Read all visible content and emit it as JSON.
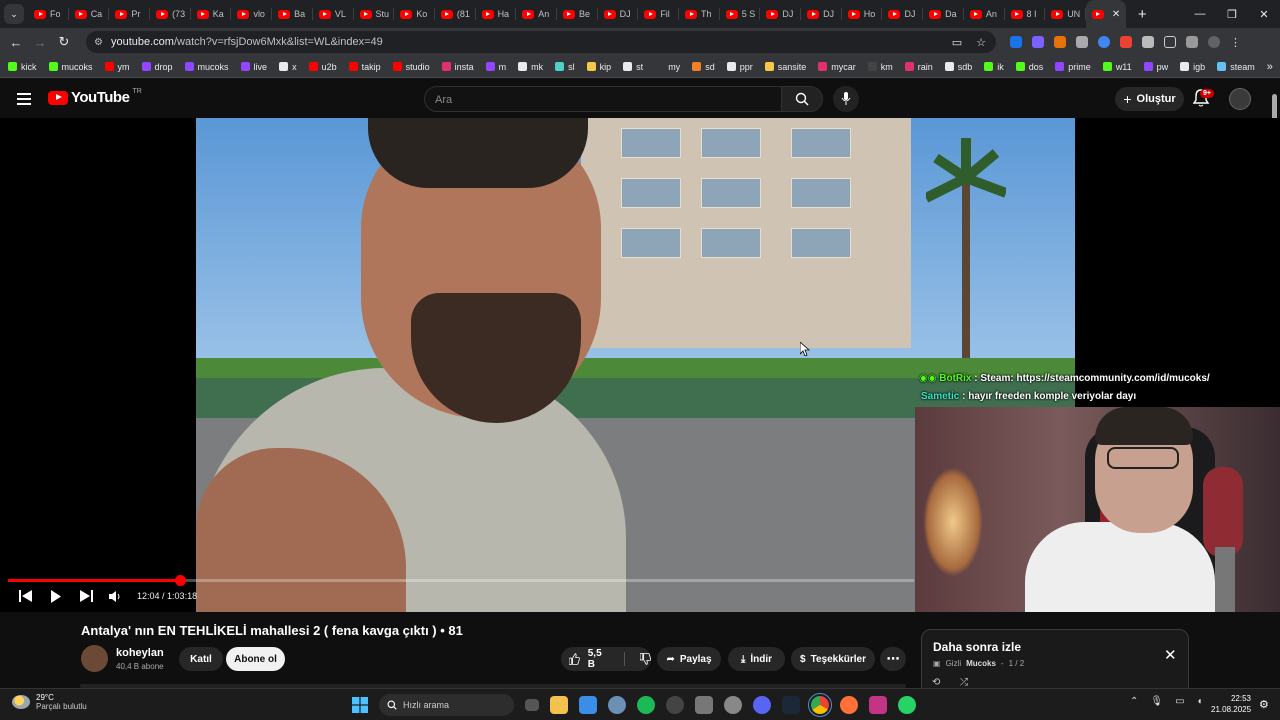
{
  "browser": {
    "tabs": [
      "Fo",
      "Ca",
      "Pr",
      "(73",
      "Ka",
      "vlo",
      "Ba",
      "VL",
      "Stu",
      "Ko",
      "(81",
      "Ha",
      "An",
      "Be",
      "DJ",
      "Fil",
      "Th",
      "5 S",
      "DJ",
      "DJ",
      "Ho",
      "DJ",
      "Da",
      "An",
      "8 I",
      "UN"
    ],
    "address": {
      "host": "youtube.com",
      "path": "/watch?v=rfsjDow6Mxk&list=WL&index=49"
    },
    "bookmarks": [
      {
        "label": "kick",
        "color": "#53fc18"
      },
      {
        "label": "mucoks",
        "color": "#53fc18"
      },
      {
        "label": "ym",
        "color": "#ff0000"
      },
      {
        "label": "drop",
        "color": "#9146ff"
      },
      {
        "label": "mucoks",
        "color": "#9146ff"
      },
      {
        "label": "live",
        "color": "#9146ff"
      },
      {
        "label": "x",
        "color": "#e8eaed"
      },
      {
        "label": "u2b",
        "color": "#ff0000"
      },
      {
        "label": "takip",
        "color": "#ff0000"
      },
      {
        "label": "studio",
        "color": "#ff0000"
      },
      {
        "label": "insta",
        "color": "#e1306c"
      },
      {
        "label": "m",
        "color": "#9146ff"
      },
      {
        "label": "mk",
        "color": "#e8eaed"
      },
      {
        "label": "sl",
        "color": "#4fd1c5"
      },
      {
        "label": "kip",
        "color": "#f7c948"
      },
      {
        "label": "st",
        "color": "#e8eaed"
      },
      {
        "label": "my",
        "color": "#35363a"
      },
      {
        "label": "sd",
        "color": "#f48024"
      },
      {
        "label": "ppr",
        "color": "#e8eaed"
      },
      {
        "label": "sansite",
        "color": "#f7c948"
      },
      {
        "label": "mycar",
        "color": "#e1306c"
      },
      {
        "label": "km",
        "color": "#444444"
      },
      {
        "label": "rain",
        "color": "#e1306c"
      },
      {
        "label": "sdb",
        "color": "#e8eaed"
      },
      {
        "label": "ik",
        "color": "#53fc18"
      },
      {
        "label": "dos",
        "color": "#53fc18"
      },
      {
        "label": "prime",
        "color": "#9146ff"
      },
      {
        "label": "w11",
        "color": "#53fc18"
      },
      {
        "label": "pw",
        "color": "#9146ff"
      },
      {
        "label": "igb",
        "color": "#e8eaed"
      },
      {
        "label": "steam",
        "color": "#66c0f4"
      }
    ]
  },
  "youtube": {
    "logo_text": "YouTube",
    "logo_region": "TR",
    "search_placeholder": "Ara",
    "create_label": "Oluştur",
    "notif_count": "9+"
  },
  "player": {
    "current_time": "12:04",
    "duration": "1:03:18",
    "progress": 0.19,
    "chat": [
      {
        "user": "BotRix",
        "user_color": "#53fc18",
        "text": " : Steam: https://steamcommunity.com/id/mucoks/"
      },
      {
        "user": "Sametic",
        "user_color": "#2ee6c9",
        "text": " : hayır freeden komple veriyolar dayı"
      }
    ]
  },
  "video": {
    "title": "Antalya' nın EN TEHLİKELİ mahallesi 2 ( fena kavga çıktı ) • 81",
    "channel": "koheylan",
    "subscribers": "40,4 B abone",
    "join_label": "Katıl",
    "subscribe_label": "Abone ol",
    "likes": "5,5 B",
    "share_label": "Paylaş",
    "download_label": "İndir",
    "thanks_label": "Teşekkürler"
  },
  "watch_later": {
    "title": "Daha sonra izle",
    "privacy": "Gizli",
    "owner": "Mucoks",
    "position": "1 / 2"
  },
  "taskbar": {
    "temperature": "29°C",
    "weather": "Parçalı bulutlu",
    "search_placeholder": "Hızlı arama",
    "time": "22:53",
    "date": "21.08.2025"
  }
}
